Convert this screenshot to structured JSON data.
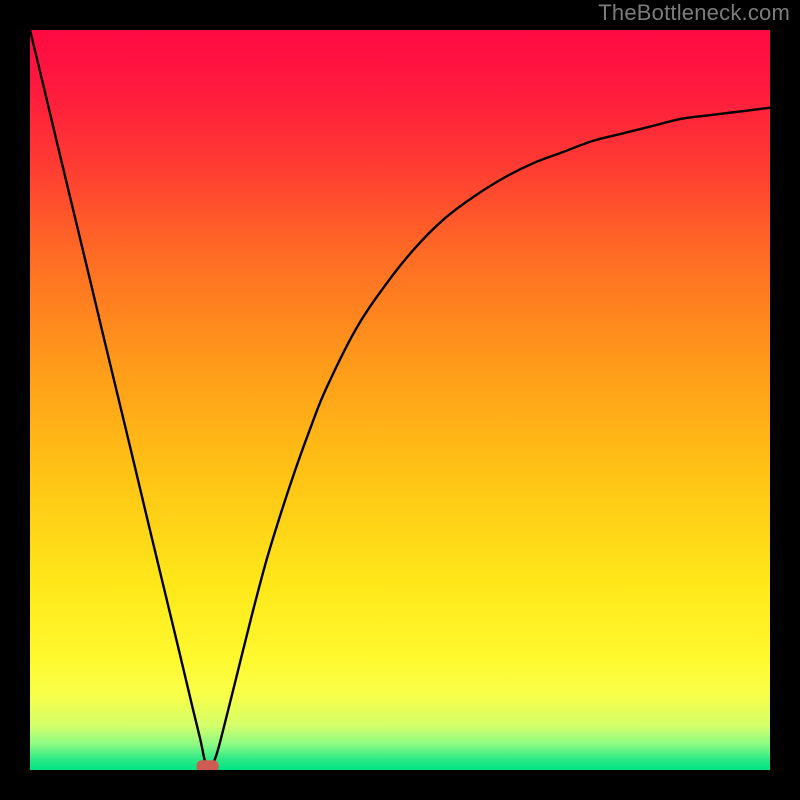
{
  "watermark": "TheBottleneck.com",
  "chart_data": {
    "type": "line",
    "title": "",
    "xlabel": "",
    "ylabel": "",
    "xlim": [
      0,
      100
    ],
    "ylim": [
      0,
      100
    ],
    "grid": false,
    "legend": false,
    "marker": {
      "x": 24,
      "y": 0.5,
      "color": "#cf5b55"
    },
    "series": [
      {
        "name": "curve",
        "x": [
          0,
          2,
          4,
          6,
          8,
          10,
          12,
          14,
          16,
          18,
          20,
          22,
          23,
          24,
          25,
          26,
          28,
          30,
          32,
          34,
          36,
          38,
          40,
          44,
          48,
          52,
          56,
          60,
          64,
          68,
          72,
          76,
          80,
          84,
          88,
          92,
          96,
          100
        ],
        "y": [
          100,
          91.7,
          83.3,
          75.0,
          66.7,
          58.3,
          50.0,
          41.7,
          33.3,
          25.0,
          16.7,
          8.3,
          4.2,
          0.0,
          1.5,
          5.0,
          13.0,
          21.0,
          28.5,
          35.0,
          41.0,
          46.5,
          51.5,
          59.5,
          65.5,
          70.5,
          74.5,
          77.5,
          80.0,
          82.0,
          83.5,
          85.0,
          86.0,
          87.0,
          88.0,
          88.5,
          89.0,
          89.5
        ]
      }
    ],
    "gradient_stops": [
      {
        "offset": 0.0,
        "color": "#ff0a43"
      },
      {
        "offset": 0.08,
        "color": "#ff1a3e"
      },
      {
        "offset": 0.18,
        "color": "#ff3a33"
      },
      {
        "offset": 0.3,
        "color": "#ff6a25"
      },
      {
        "offset": 0.45,
        "color": "#ff9a1a"
      },
      {
        "offset": 0.6,
        "color": "#ffc315"
      },
      {
        "offset": 0.75,
        "color": "#ffe81a"
      },
      {
        "offset": 0.85,
        "color": "#fff92f"
      },
      {
        "offset": 0.9,
        "color": "#f8ff4a"
      },
      {
        "offset": 0.94,
        "color": "#d4ff6a"
      },
      {
        "offset": 0.965,
        "color": "#8dfb84"
      },
      {
        "offset": 0.985,
        "color": "#2eea86"
      },
      {
        "offset": 1.0,
        "color": "#00e383"
      }
    ]
  }
}
